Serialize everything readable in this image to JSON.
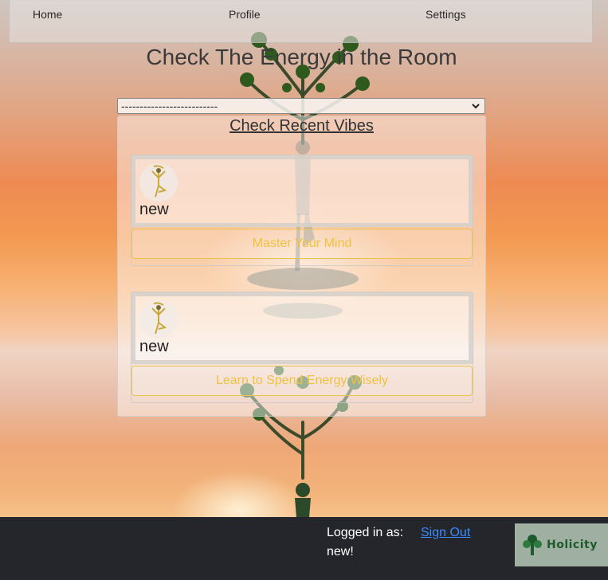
{
  "nav": {
    "home": "Home",
    "profile": "Profile",
    "settings": "Settings"
  },
  "page_title": "Check The Energy in the Room",
  "select": {
    "selected": "--------------------------"
  },
  "panel": {
    "title": "Check Recent Vibes",
    "cards": [
      {
        "text": "new",
        "button": "Master Your Mind",
        "avatar_icon": "yoga-figure-icon"
      },
      {
        "text": "new",
        "button": "Learn to Spend Energy Wisely",
        "avatar_icon": "yoga-figure-icon"
      }
    ]
  },
  "footer": {
    "logged_in_label": "Logged in as:",
    "username": "new!",
    "sign_out": "Sign Out",
    "logo_text": "Holicity"
  },
  "colors": {
    "footer_bg": "#24262b",
    "button_text": "#f0c040",
    "link": "#3a8bff",
    "logo_bg": "#9fb0a2"
  }
}
